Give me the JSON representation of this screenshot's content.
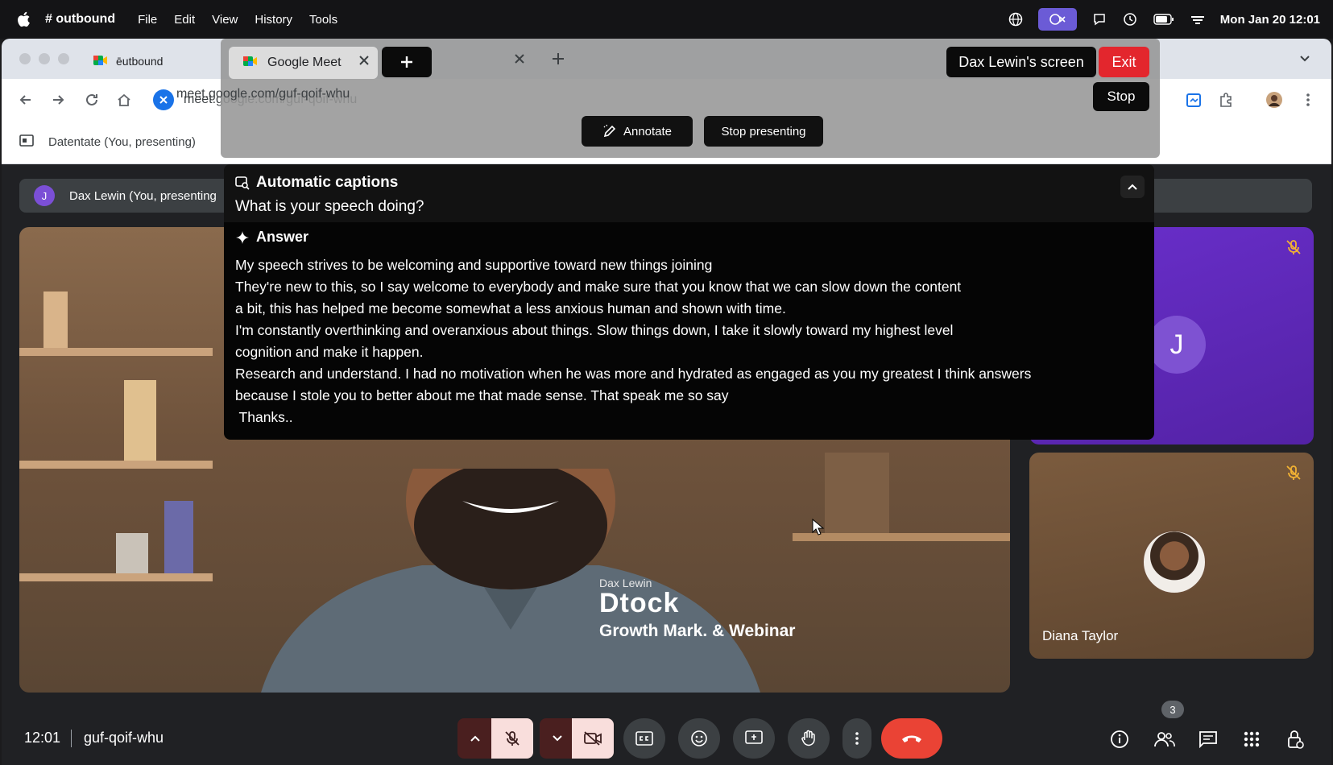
{
  "menubar": {
    "app_name": "# outbound",
    "items": [
      "File",
      "Edit",
      "View",
      "History",
      "Tools"
    ],
    "clock": "Mon Jan 20 12:01"
  },
  "browser": {
    "tab_title": "ēutbound",
    "url": "meet.google.com/guf-qoif-whu"
  },
  "meet": {
    "presenting_banner": "Datentate (You, presenting)",
    "presenting_pill": "Dax Lewin (You, presenting",
    "pill_avatar": "J",
    "brand_small": "Dax Lewin",
    "brand_big": "Dtock",
    "brand_sub": "Growth Mark. & Webinar",
    "tile_avatar": "J",
    "tile_name": "Diana Taylor",
    "time": "12:01",
    "meeting_code": "guf-qoif-whu",
    "participant_count": "3"
  },
  "share": {
    "tab_title": "Google Meet",
    "url": "meet.google.com/guf-qoif-whu",
    "annotate": "Annotate",
    "stop_presenting": "Stop presenting",
    "screen_label": "Dax Lewin's screen",
    "exit": "Exit",
    "stop": "Stop"
  },
  "captions": {
    "title": "Automatic captions",
    "question": "What is your speech doing?",
    "answer_label": "Answer",
    "lines": [
      "My speech strives to be welcoming and supportive toward new things joining",
      "They're new to this, so I say welcome to everybody and make sure that you know that we can slow down the content",
      "a bit, this has helped me become somewhat a less anxious human and shown with time.",
      "I'm constantly overthinking and overanxious about things. Slow things down, I take it slowly toward my highest level",
      "cognition and make it happen.",
      "Research and understand. I had no motivation when he was more and hydrated as engaged as you my greatest I think answers",
      "because I stole you to better about me that made sense. That speak me so say",
      " Thanks.."
    ]
  },
  "colors": {
    "end_call": "#ea4335",
    "exit": "#e3262d",
    "tile_purple": "#6a2fcc",
    "accent_blue": "#1a73e8"
  }
}
